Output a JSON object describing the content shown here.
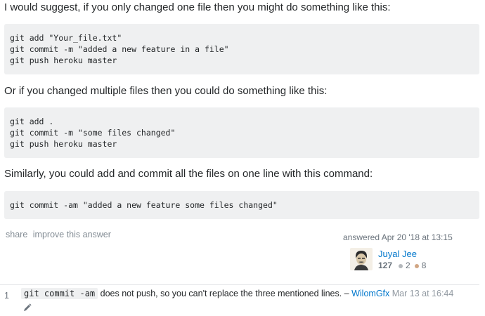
{
  "answer": {
    "paragraphs": [
      "I would suggest, if you only changed one file then you might do something like this:",
      "Or if you changed multiple files then you could do something like this:",
      "Similarly, you could add and commit all the files on one line with this command:"
    ],
    "code_blocks": [
      [
        "git add \"Your_file.txt\"",
        "git commit -m \"added a new feature in a file\"",
        "git push heroku master"
      ],
      [
        "git add .",
        "git commit -m \"some files changed\"",
        "git push heroku master"
      ],
      [
        "git commit -am \"added a new feature some files changed\""
      ]
    ]
  },
  "post_menu": {
    "share_label": "share",
    "improve_label": "improve this answer"
  },
  "user_info": {
    "action_time": "answered Apr 20 '18 at 13:15",
    "name": "Juyal Jee",
    "reputation": "127",
    "silver_badges": "2",
    "bronze_badges": "8",
    "silver_color": "#b4b8bc",
    "bronze_color": "#d1a684"
  },
  "comment": {
    "score": "1",
    "code": "git commit -am",
    "text": " does not push, so you can't replace the three mentioned lines. – ",
    "user": "WilomGfx",
    "date": "Mar 13 at 16:44"
  },
  "icons": {
    "edit": "pencil-icon"
  }
}
